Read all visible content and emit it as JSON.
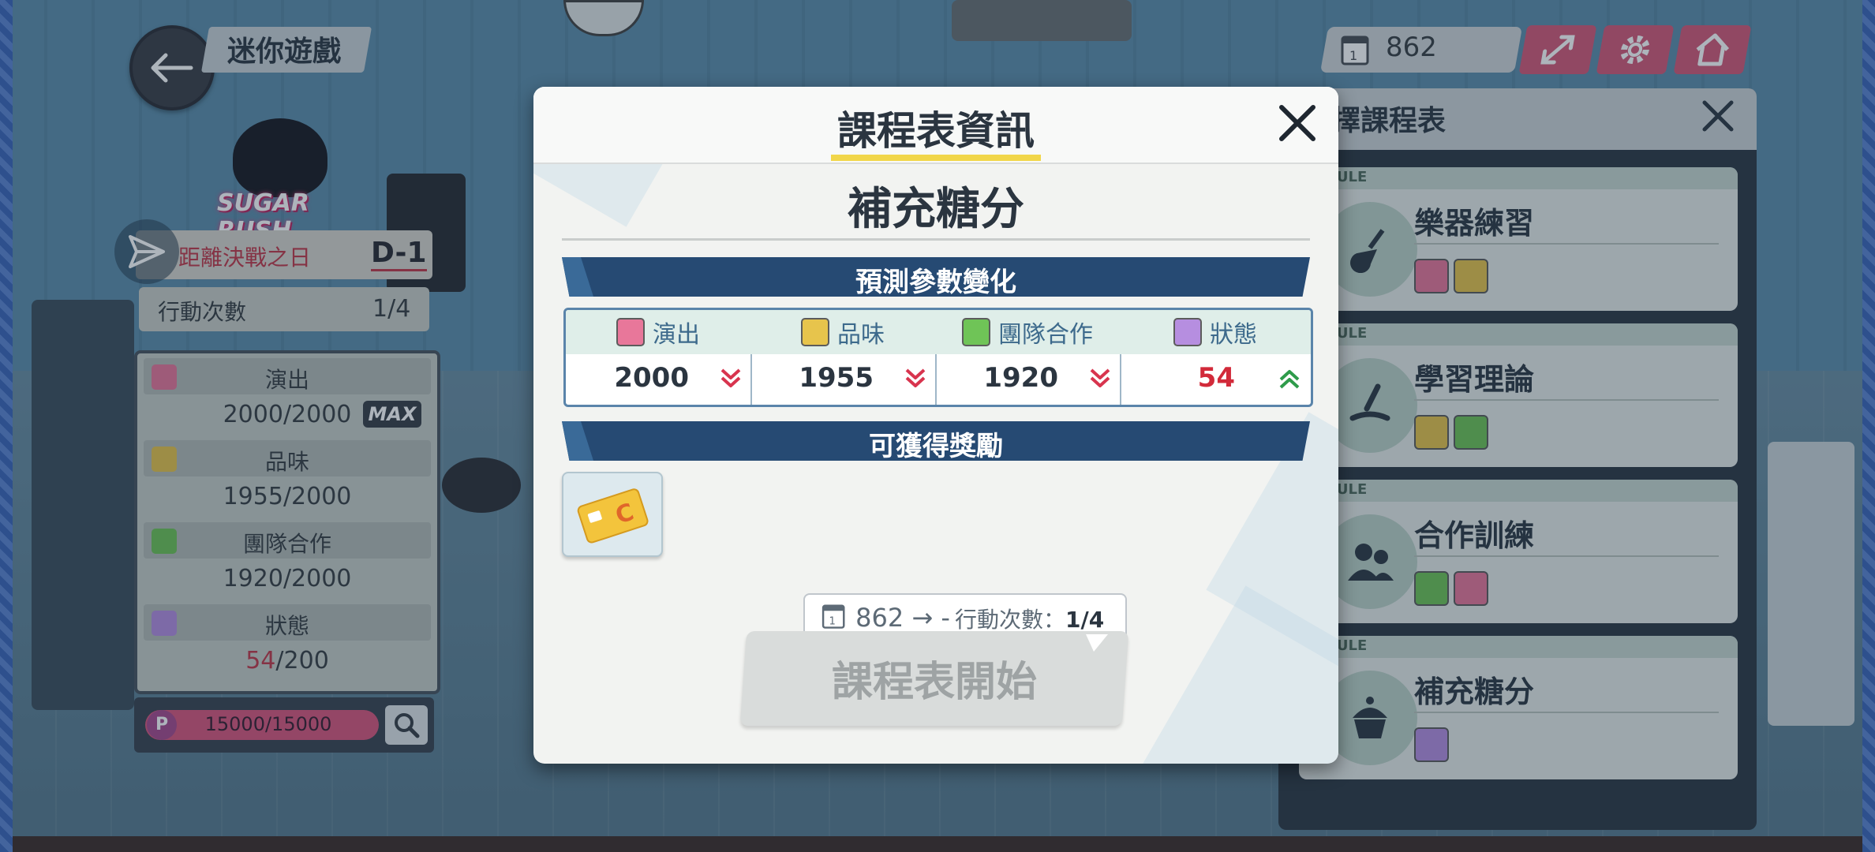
{
  "top_left": {
    "title": "迷你遊戲"
  },
  "logo": {
    "text": "SUGAR RUSH"
  },
  "countdown": {
    "label": "距離決戰之日",
    "value": "D-1"
  },
  "actions": {
    "label": "行動次數",
    "value": "1/4"
  },
  "stats_panel": [
    {
      "name": "演出",
      "value": "2000/2000",
      "badge": "MAX",
      "icon": "microphone-icon",
      "color": "#e8779a"
    },
    {
      "name": "品味",
      "value": "1955/2000",
      "icon": "taste-icon",
      "color": "#e7c44c"
    },
    {
      "name": "團隊合作",
      "value": "1920/2000",
      "icon": "teamwork-icon",
      "color": "#6fc457"
    },
    {
      "name": "狀態",
      "value_highlight": "54",
      "value_rest": "/200",
      "icon": "cake-icon",
      "color": "#b68ee0"
    }
  ],
  "currency": {
    "value": "15000/15000",
    "symbol": "P"
  },
  "top_right": {
    "stamina": "862"
  },
  "schedule": {
    "title": "選擇課程表",
    "title_visible": "擇課程表",
    "tag": "SCHEDULE",
    "tag_visible": "IEDULE",
    "cards": [
      {
        "name": "樂器練習",
        "icon": "guitar-icon",
        "stats": [
          "microphone-icon",
          "taste-icon"
        ]
      },
      {
        "name": "學習理論",
        "icon": "pen-book-icon",
        "stats": [
          "taste-icon",
          "teamwork-icon"
        ]
      },
      {
        "name": "合作訓練",
        "icon": "people-icon",
        "stats": [
          "teamwork-icon",
          "microphone-icon"
        ]
      },
      {
        "name": "補充糖分",
        "icon": "cupcake-icon",
        "stats": [
          "cake-icon"
        ]
      }
    ]
  },
  "modal": {
    "title": "課程表資訊",
    "lesson_name": "補充糖分",
    "predict_header": "預測參數變化",
    "params": [
      {
        "name": "演出",
        "value": "2000",
        "trend": "down",
        "icon": "microphone-icon",
        "color": "#e8779a"
      },
      {
        "name": "品味",
        "value": "1955",
        "trend": "down",
        "icon": "taste-icon",
        "color": "#e7c44c"
      },
      {
        "name": "團隊合作",
        "value": "1920",
        "trend": "down",
        "icon": "teamwork-icon",
        "color": "#6fc457"
      },
      {
        "name": "狀態",
        "value": "54",
        "trend": "up",
        "icon": "cake-icon",
        "color": "#b68ee0"
      }
    ],
    "reward_header": "可獲得獎勵",
    "reward_icon": "card-icon",
    "cost": {
      "stamina_from": "862",
      "arrow": "→",
      "stamina_to": "-",
      "actions_label": "行動次數：",
      "actions_value": "1/4"
    },
    "start_button": "課程表開始"
  }
}
